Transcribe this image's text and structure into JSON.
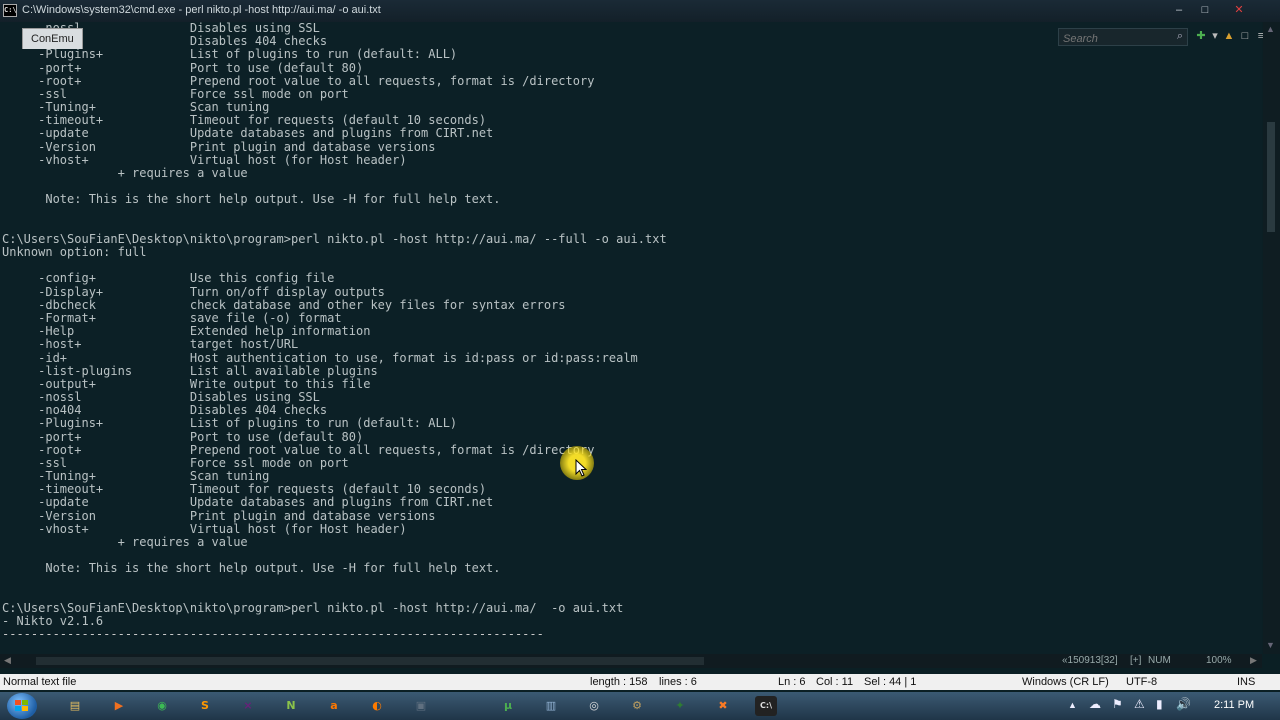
{
  "window": {
    "title": "C:\\Windows\\system32\\cmd.exe - perl  nikto.pl -host http://aui.ma/  -o aui.txt",
    "sys_icon": "C:\\",
    "controls": [
      "–",
      "□",
      "✕"
    ]
  },
  "toolbar": {
    "tab_label": "ConEmu",
    "search_placeholder": "Search"
  },
  "terminal": {
    "lines": [
      {
        "row": 0,
        "text": "     -nossl               Disables using SSL"
      },
      {
        "row": 1,
        "text": "     -no404               Disables 404 checks"
      },
      {
        "row": 2,
        "text": "     -Plugins+            List of plugins to run (default: ALL)"
      },
      {
        "row": 3,
        "text": "     -port+               Port to use (default 80)"
      },
      {
        "row": 4,
        "text": "     -root+               Prepend root value to all requests, format is /directory"
      },
      {
        "row": 5,
        "text": "     -ssl                 Force ssl mode on port"
      },
      {
        "row": 6,
        "text": "     -Tuning+             Scan tuning"
      },
      {
        "row": 7,
        "text": "     -timeout+            Timeout for requests (default 10 seconds)"
      },
      {
        "row": 8,
        "text": "     -update              Update databases and plugins from CIRT.net"
      },
      {
        "row": 9,
        "text": "     -Version             Print plugin and database versions"
      },
      {
        "row": 10,
        "text": "     -vhost+              Virtual host (for Host header)"
      },
      {
        "row": 11,
        "text": "                + requires a value"
      },
      {
        "row": 13,
        "text": "      Note: This is the short help output. Use -H for full help text."
      },
      {
        "row": 16,
        "text": "C:\\Users\\SouFianE\\Desktop\\nikto\\program>perl nikto.pl -host http://aui.ma/ --full -o aui.txt"
      },
      {
        "row": 17,
        "text": "Unknown option: full"
      },
      {
        "row": 19,
        "text": "     -config+             Use this config file"
      },
      {
        "row": 20,
        "text": "     -Display+            Turn on/off display outputs"
      },
      {
        "row": 21,
        "text": "     -dbcheck             check database and other key files for syntax errors"
      },
      {
        "row": 22,
        "text": "     -Format+             save file (-o) format"
      },
      {
        "row": 23,
        "text": "     -Help                Extended help information"
      },
      {
        "row": 24,
        "text": "     -host+               target host/URL"
      },
      {
        "row": 25,
        "text": "     -id+                 Host authentication to use, format is id:pass or id:pass:realm"
      },
      {
        "row": 26,
        "text": "     -list-plugins        List all available plugins"
      },
      {
        "row": 27,
        "text": "     -output+             Write output to this file"
      },
      {
        "row": 28,
        "text": "     -nossl               Disables using SSL"
      },
      {
        "row": 29,
        "text": "     -no404               Disables 404 checks"
      },
      {
        "row": 30,
        "text": "     -Plugins+            List of plugins to run (default: ALL)"
      },
      {
        "row": 31,
        "text": "     -port+               Port to use (default 80)"
      },
      {
        "row": 32,
        "text": "     -root+               Prepend root value to all requests, format is /directory"
      },
      {
        "row": 33,
        "text": "     -ssl                 Force ssl mode on port"
      },
      {
        "row": 34,
        "text": "     -Tuning+             Scan tuning"
      },
      {
        "row": 35,
        "text": "     -timeout+            Timeout for requests (default 10 seconds)"
      },
      {
        "row": 36,
        "text": "     -update              Update databases and plugins from CIRT.net"
      },
      {
        "row": 37,
        "text": "     -Version             Print plugin and database versions"
      },
      {
        "row": 38,
        "text": "     -vhost+              Virtual host (for Host header)"
      },
      {
        "row": 39,
        "text": "                + requires a value"
      },
      {
        "row": 41,
        "text": "      Note: This is the short help output. Use -H for full help text."
      },
      {
        "row": 44,
        "text": "C:\\Users\\SouFianE\\Desktop\\nikto\\program>perl nikto.pl -host http://aui.ma/  -o aui.txt"
      },
      {
        "row": 45,
        "text": "- Nikto v2.1.6"
      },
      {
        "row": 46,
        "text": "---------------------------------------------------------------------------",
        "rule": true
      }
    ]
  },
  "scrollbar": {
    "position_info": "«150913[32]",
    "mode": "[+]",
    "num": "NUM",
    "zoom": "100%"
  },
  "statusbar": {
    "file_type": "Normal text file",
    "length": "length : 158",
    "lines": "lines : 6",
    "ln": "Ln : 6",
    "col": "Col : 11",
    "sel": "Sel : 44 | 1",
    "eol": "Windows (CR LF)",
    "encoding": "UTF-8",
    "ins": "INS"
  },
  "taskbar": {
    "apps": [
      {
        "name": "explorer",
        "icon": "folder-icon",
        "glyph": "▤",
        "color": "#e8c060"
      },
      {
        "name": "media",
        "icon": "media-icon",
        "glyph": "▶",
        "color": "#f07020"
      },
      {
        "name": "chrome",
        "icon": "chrome-icon",
        "glyph": "◉",
        "color": "#3cba54"
      },
      {
        "name": "sublime",
        "icon": "sublime-icon",
        "glyph": "S",
        "color": "#ff9800"
      },
      {
        "name": "vs",
        "icon": "visual-studio-icon",
        "glyph": "⨯",
        "color": "#68217a"
      },
      {
        "name": "notepad++",
        "icon": "notepad-icon",
        "glyph": "N",
        "color": "#8bc34a"
      },
      {
        "name": "avast",
        "icon": "avast-icon",
        "glyph": "a",
        "color": "#ff7800"
      },
      {
        "name": "firefox",
        "icon": "firefox-icon",
        "glyph": "◐",
        "color": "#ff7b00"
      },
      {
        "name": "terminal-app",
        "icon": "console-icon",
        "glyph": "▣",
        "color": "#607080"
      },
      {
        "name": "utorrent",
        "icon": "utorrent-icon",
        "glyph": "µ",
        "color": "#4caf50"
      },
      {
        "name": "files",
        "icon": "document-icon",
        "glyph": "▥",
        "color": "#90b0d0"
      },
      {
        "name": "network",
        "icon": "globe-icon",
        "glyph": "◎",
        "color": "#e0e0e0"
      },
      {
        "name": "tool",
        "icon": "tool-icon",
        "glyph": "⚙",
        "color": "#c0a060"
      },
      {
        "name": "flag-app",
        "icon": "flag-icon",
        "glyph": "✦",
        "color": "#2e7d32"
      },
      {
        "name": "xampp",
        "icon": "xampp-icon",
        "glyph": "✖",
        "color": "#fb7a24"
      },
      {
        "name": "cmd",
        "icon": "cmd-icon",
        "glyph": "C:\\",
        "color": "#1a1a1a"
      }
    ],
    "tray": [
      "▲",
      "☁",
      "⚑",
      "⚠",
      "▮",
      "🔊"
    ],
    "clock": "2:11 PM"
  }
}
